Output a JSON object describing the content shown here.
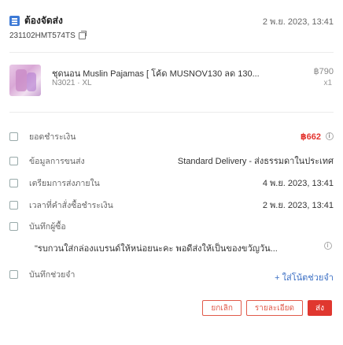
{
  "header": {
    "status": "ต้องจัดส่ง",
    "date": "2 พ.ย. 2023, 13:41",
    "order_id": "231102HMT574TS"
  },
  "product": {
    "name": "ชุดนอน Muslin Pajamas [ โค้ด MUSNOV130 ลด 130...",
    "price": "฿790",
    "variant": "N3021 · XL",
    "qty": "x1"
  },
  "rows": {
    "total_label": "ยอดชำระเงิน",
    "total_value": "฿662",
    "shipping_label": "ข้อมูลการขนส่ง",
    "shipping_value": "Standard Delivery - ส่งธรรมดาในประเทศ",
    "prepare_label": "เตรียมการส่งภายใน",
    "prepare_value": "4 พ.ย. 2023, 13:41",
    "paid_time_label": "เวลาที่คำสั่งซื้อชำระเงิน",
    "paid_time_value": "2 พ.ย. 2023, 13:41",
    "buyer_note_label": "บันทึกผู้ซื้อ",
    "buyer_note_text": "\"รบกวนใส่กล่องแบรนด์ให้หน่อยนะคะ พอดีส่งให้เป็นของขวัญวัน...",
    "memo_label": "บันทึกช่วยจำ",
    "add_memo": "+ ใส่โน้ตช่วยจำ"
  },
  "buttons": {
    "cancel": "ยกเลิก",
    "details": "รายละเอียด",
    "ship": "ส่ง"
  }
}
